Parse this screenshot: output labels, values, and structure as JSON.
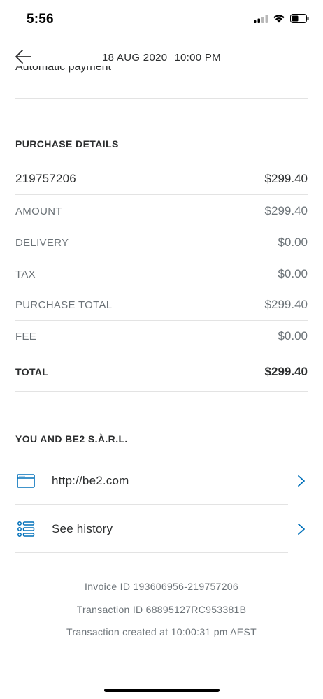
{
  "status_bar": {
    "time": "5:56"
  },
  "header": {
    "date": "18 AUG 2020",
    "time": "10:00 PM"
  },
  "cutoff_text": "Automatic payment",
  "purchase": {
    "section_title": "PURCHASE DETAILS",
    "invoice_number": "219757206",
    "invoice_amount": "$299.40",
    "rows": [
      {
        "label": "AMOUNT",
        "value": "$299.40"
      },
      {
        "label": "DELIVERY",
        "value": "$0.00"
      },
      {
        "label": "TAX",
        "value": "$0.00"
      },
      {
        "label": "PURCHASE TOTAL",
        "value": "$299.40"
      },
      {
        "label": "FEE",
        "value": "$0.00"
      }
    ],
    "total_label": "TOTAL",
    "total_value": "$299.40"
  },
  "merchant": {
    "section_title": "YOU AND BE2 S.À.R.L.",
    "links": [
      {
        "label": "http://be2.com",
        "icon": "browser-window-icon"
      },
      {
        "label": "See history",
        "icon": "list-icon"
      }
    ]
  },
  "footer": {
    "invoice_id": "Invoice ID 193606956-219757206",
    "transaction_id": "Transaction ID 68895127RC953381B",
    "created_at": "Transaction created at 10:00:31 pm AEST"
  },
  "colors": {
    "accent": "#0070ba",
    "text": "#2c2e2f",
    "muted": "#6c7378"
  }
}
